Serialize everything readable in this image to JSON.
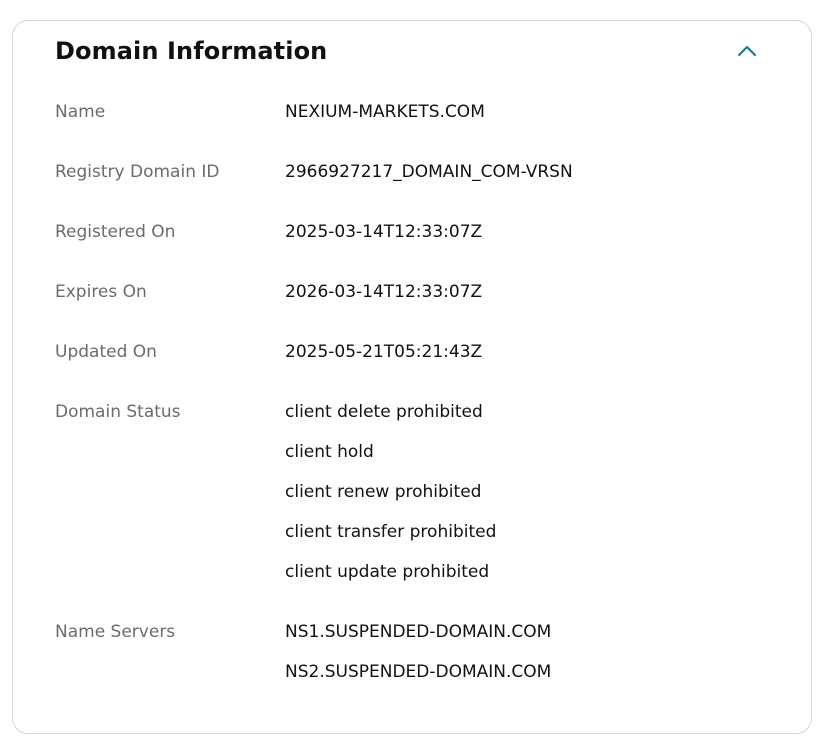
{
  "panel": {
    "title": "Domain Information",
    "toggle_icon": "chevron-up-icon",
    "accent_color": "#1a7f8e"
  },
  "fields": {
    "name": {
      "label": "Name",
      "value": "NEXIUM-MARKETS.COM"
    },
    "registry_domain_id": {
      "label": "Registry Domain ID",
      "value": "2966927217_DOMAIN_COM-VRSN"
    },
    "registered_on": {
      "label": "Registered On",
      "value": "2025-03-14T12:33:07Z"
    },
    "expires_on": {
      "label": "Expires On",
      "value": "2026-03-14T12:33:07Z"
    },
    "updated_on": {
      "label": "Updated On",
      "value": "2025-05-21T05:21:43Z"
    },
    "domain_status": {
      "label": "Domain Status",
      "values": [
        "client delete prohibited",
        "client hold",
        "client renew prohibited",
        "client transfer prohibited",
        "client update prohibited"
      ]
    },
    "name_servers": {
      "label": "Name Servers",
      "values": [
        "NS1.SUSPENDED-DOMAIN.COM",
        "NS2.SUSPENDED-DOMAIN.COM"
      ]
    }
  }
}
